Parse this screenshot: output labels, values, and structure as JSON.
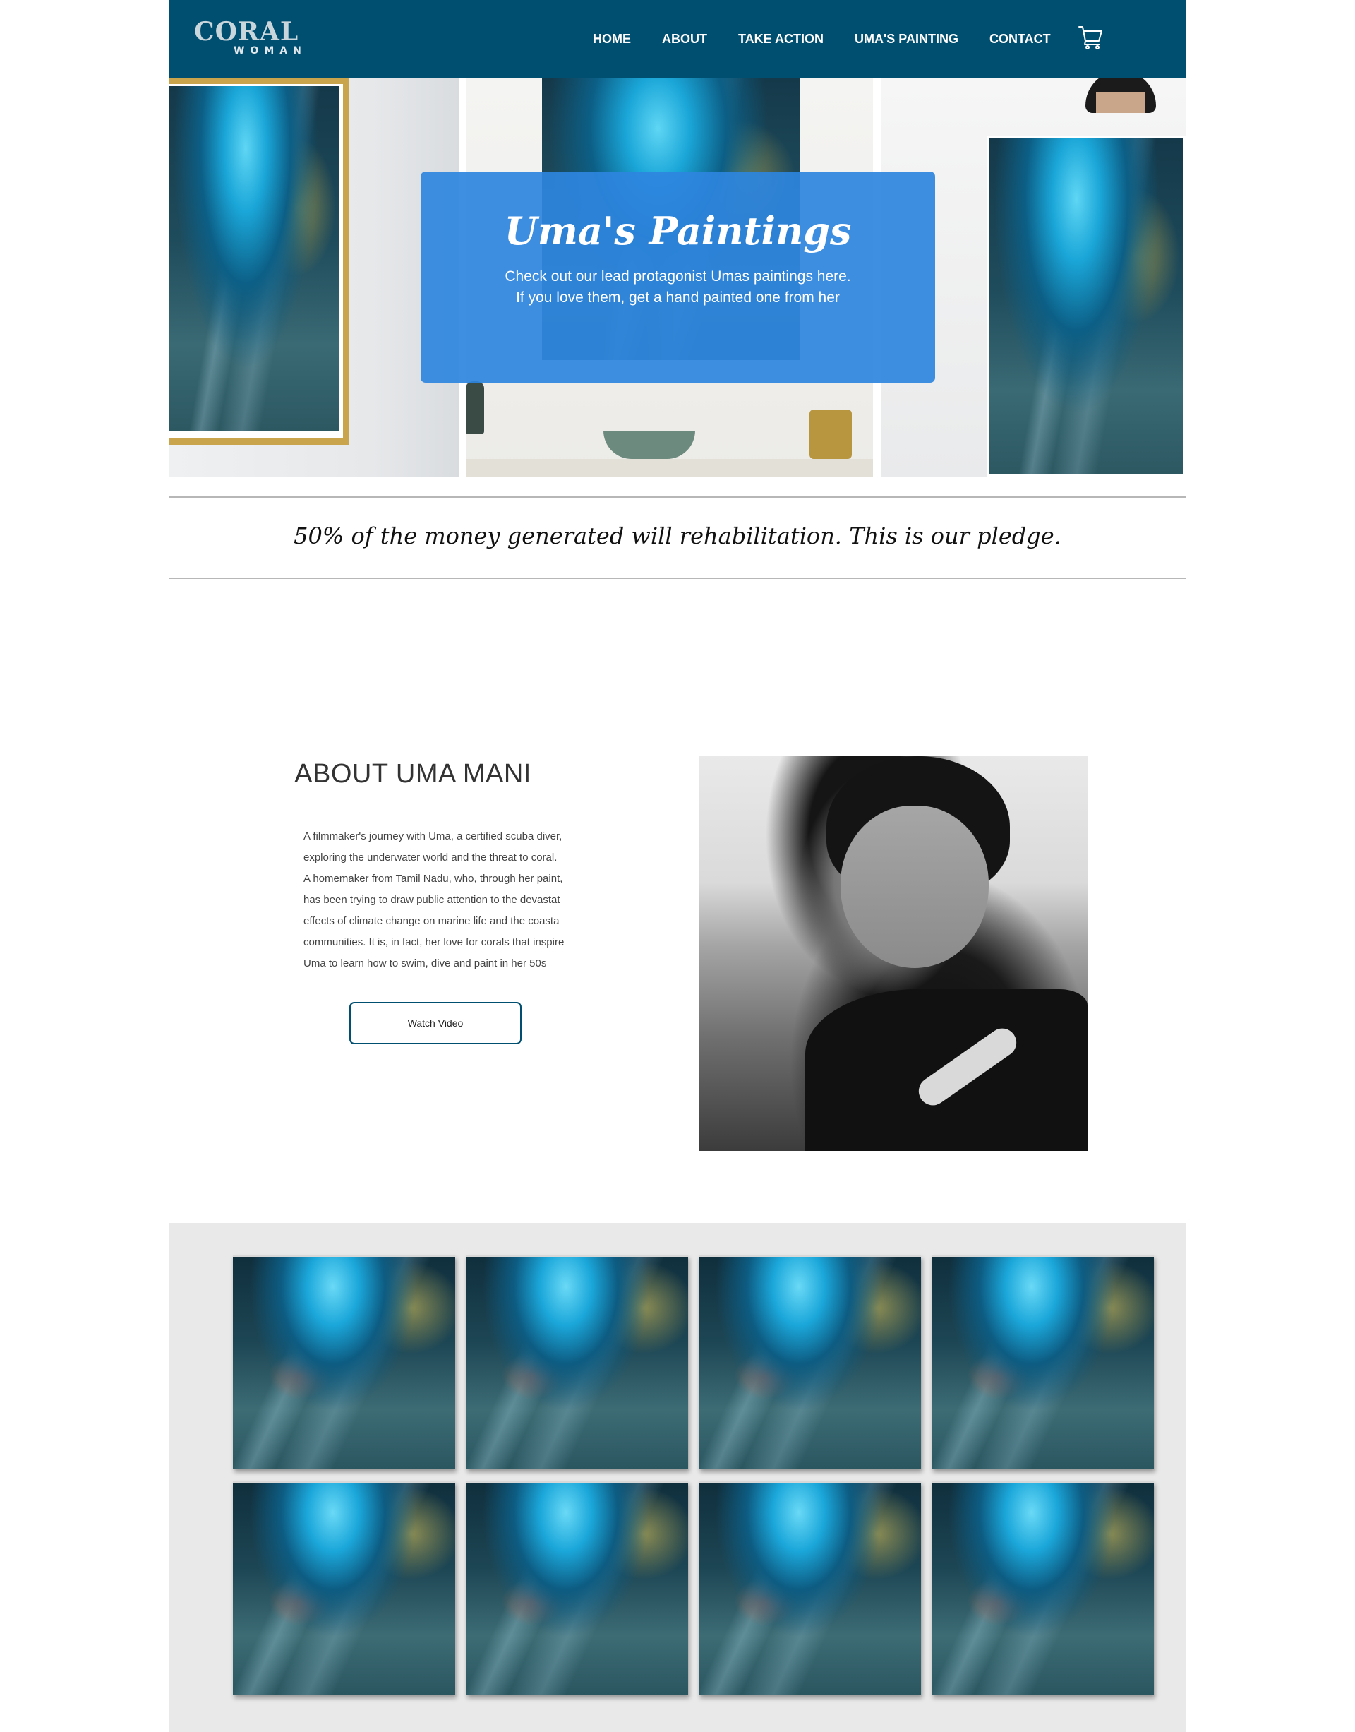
{
  "header": {
    "logo_main": "CORAL",
    "logo_sub": "WOMAN",
    "nav": [
      "HOME",
      "ABOUT",
      "TAKE ACTION",
      "UMA'S PAINTING",
      "CONTACT"
    ],
    "cart_icon": "shopping-cart-icon"
  },
  "hero": {
    "title": "Uma's Paintings",
    "subtitle_line1": "Check out our lead protagonist Umas paintings here.",
    "subtitle_line2": "If you love them, get a hand painted one from her"
  },
  "pledge": {
    "text": "50% of the money generated will rehabilitation. This is our pledge."
  },
  "about": {
    "title": "ABOUT UMA MANI",
    "body": [
      "A filmmaker's journey with Uma, a certified scuba diver,",
      "exploring the underwater world and the threat to coral.",
      "A homemaker from Tamil Nadu, who, through her paint,",
      "has been trying to draw public attention to the devastat",
      "effects of climate change on marine life and the coasta",
      "communities. It is, in fact, her love for corals that inspire",
      "Uma to learn how to swim, dive and paint in her 50s"
    ],
    "button": "Watch Video"
  },
  "colors": {
    "header_bg": "#004f71",
    "hero_card": "#2e86de",
    "gallery_bg": "#e9e9e9"
  }
}
